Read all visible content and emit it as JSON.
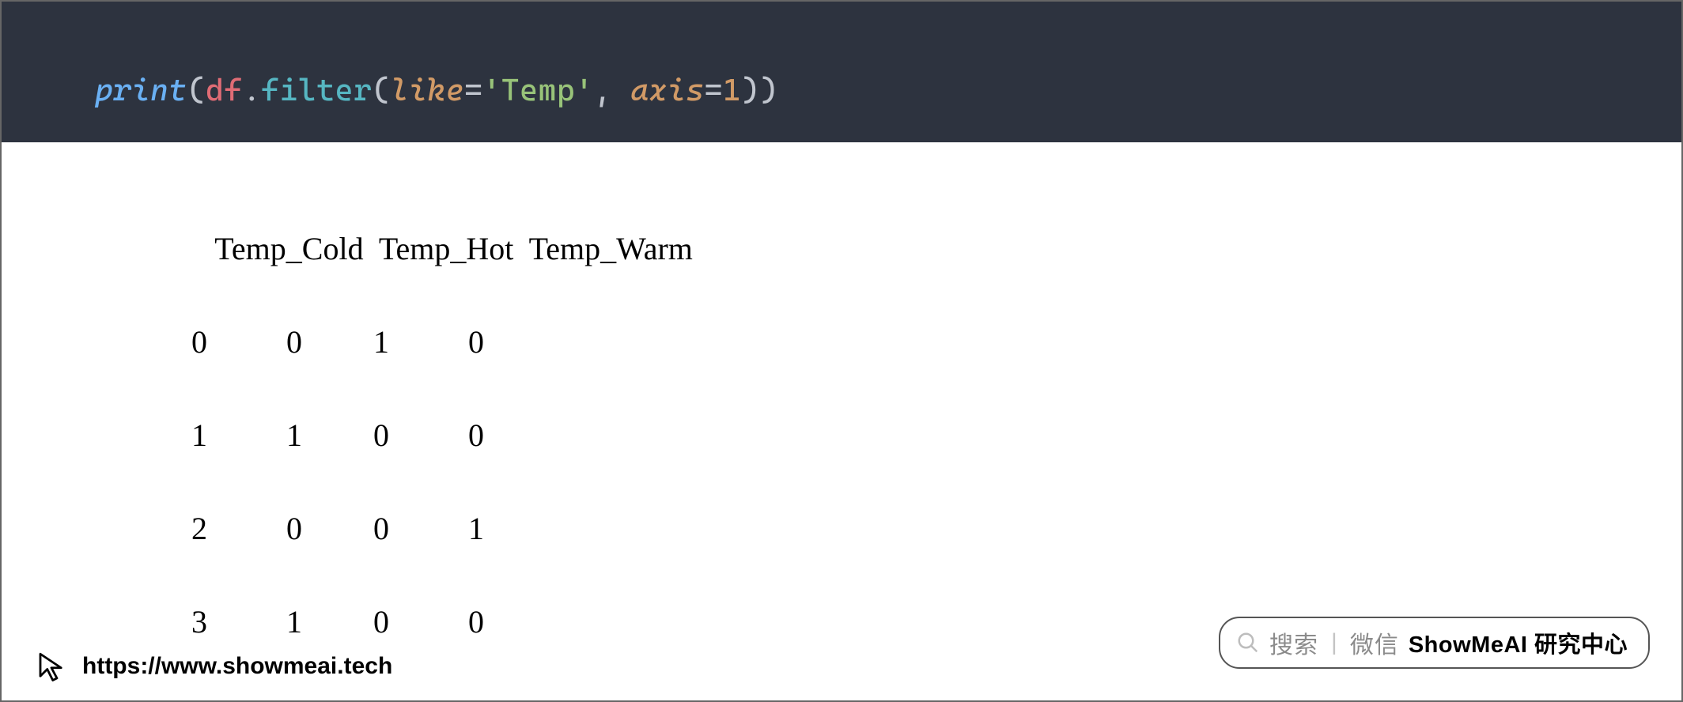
{
  "code": {
    "print": "print",
    "lp1": "(",
    "df": "df",
    "dot": ".",
    "filter": "filter",
    "lp2": "(",
    "like_kw": "like",
    "eq1": "=",
    "like_val": "'Temp'",
    "comma": ", ",
    "axis_kw": "axis",
    "eq2": "=",
    "axis_val": "1",
    "rp2": ")",
    "rp1": ")"
  },
  "output": {
    "header": "   Temp_Cold  Temp_Hot  Temp_Warm",
    "rows": [
      "0          0         1          0",
      "1          1         0          0",
      "2          0         0          1",
      "3          1         0          0"
    ]
  },
  "footer": {
    "url": "https://www.showmeai.tech"
  },
  "search_pill": {
    "dim1": "搜索",
    "divider": "|",
    "dim2": "微信",
    "bold": "ShowMeAI 研究中心"
  }
}
